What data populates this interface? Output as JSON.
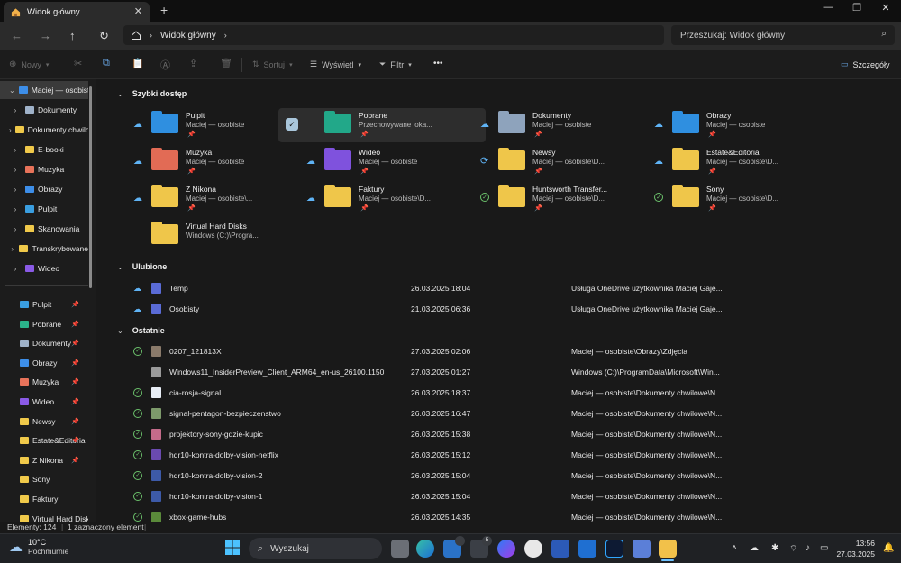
{
  "window": {
    "tab_title": "Widok główny",
    "new_tab": "+",
    "controls": [
      "—",
      "❐",
      "✕"
    ]
  },
  "address": {
    "breadcrumb": "Widok główny",
    "search_placeholder": "Przeszukaj: Widok główny"
  },
  "toolbar": {
    "new_label": "Nowy",
    "sort_label": "Sortuj",
    "view_label": "Wyświetl",
    "filter_label": "Filtr",
    "more_label": "•••",
    "details_label": "Szczegóły"
  },
  "sidebar": {
    "top": [
      {
        "label": "Maciej — osobiste",
        "color": "#3d8ee8"
      },
      {
        "label": "Dokumenty",
        "color": "#9fb2c9"
      },
      {
        "label": "Dokumenty chwilowe",
        "color": "#f0c94a"
      },
      {
        "label": "E-booki",
        "color": "#f0c94a"
      },
      {
        "label": "Muzyka",
        "color": "#e8735a"
      },
      {
        "label": "Obrazy",
        "color": "#3d8ee8"
      },
      {
        "label": "Pulpit",
        "color": "#3a9ee0"
      },
      {
        "label": "Skanowania",
        "color": "#f0c94a"
      },
      {
        "label": "Transkrybowane",
        "color": "#f0c94a"
      },
      {
        "label": "Wideo",
        "color": "#8a5ae6"
      }
    ],
    "pinned": [
      {
        "label": "Pulpit",
        "color": "#3a9ee0",
        "pin": "📌"
      },
      {
        "label": "Pobrane",
        "color": "#2bb38b",
        "pin": "📌"
      },
      {
        "label": "Dokumenty",
        "color": "#9fb2c9",
        "pin": "📌"
      },
      {
        "label": "Obrazy",
        "color": "#3d8ee8",
        "pin": "📌"
      },
      {
        "label": "Muzyka",
        "color": "#e8735a",
        "pin": "📌"
      },
      {
        "label": "Wideo",
        "color": "#8a5ae6",
        "pin": "📌"
      },
      {
        "label": "Newsy",
        "color": "#f0c94a",
        "pin": "📌"
      },
      {
        "label": "Estate&Editorial",
        "color": "#f0c94a",
        "pin": "📌"
      },
      {
        "label": "Z Nikona",
        "color": "#f0c94a",
        "pin": "📌"
      },
      {
        "label": "Sony",
        "color": "#f0c94a",
        "pin": ""
      },
      {
        "label": "Faktury",
        "color": "#f0c94a",
        "pin": ""
      },
      {
        "label": "Virtual Hard Disks",
        "color": "#f0c94a",
        "pin": ""
      }
    ]
  },
  "quick_access": {
    "title": "Szybki dostęp",
    "items": [
      {
        "name": "Pulpit",
        "sub": "Maciej — osobiste",
        "status": "cloud",
        "color": "#2f8fe0"
      },
      {
        "name": "Pobrane",
        "sub": "Przechowywane loka...",
        "status": "selected",
        "color": "#22a889"
      },
      {
        "name": "Dokumenty",
        "sub": "Maciej — osobiste",
        "status": "cloud",
        "color": "#8ea3bc"
      },
      {
        "name": "Obrazy",
        "sub": "Maciej — osobiste",
        "status": "cloud",
        "color": "#2f8fe0"
      },
      {
        "name": "Muzyka",
        "sub": "Maciej — osobiste",
        "status": "cloud",
        "color": "#e26b55"
      },
      {
        "name": "Wideo",
        "sub": "Maciej — osobiste",
        "status": "cloud",
        "color": "#7f52dd"
      },
      {
        "name": "Newsy",
        "sub": "Maciej — osobiste\\D...",
        "status": "sync",
        "color": "#efc64a"
      },
      {
        "name": "Estate&Editorial",
        "sub": "Maciej — osobiste\\D...",
        "status": "cloud",
        "color": "#efc64a"
      },
      {
        "name": "Z Nikona",
        "sub": "Maciej — osobiste\\...",
        "status": "cloud",
        "color": "#efc64a"
      },
      {
        "name": "Faktury",
        "sub": "Maciej — osobiste\\D...",
        "status": "cloud",
        "color": "#efc64a"
      },
      {
        "name": "Huntsworth Transfer...",
        "sub": "Maciej — osobiste\\D...",
        "status": "ok",
        "color": "#efc64a"
      },
      {
        "name": "Sony",
        "sub": "Maciej — osobiste\\D...",
        "status": "ok",
        "color": "#efc64a"
      },
      {
        "name": "Virtual Hard Disks",
        "sub": "Windows (C:)\\Progra...",
        "status": "",
        "color": "#efc64a"
      }
    ]
  },
  "favorites": {
    "title": "Ulubione",
    "rows": [
      {
        "name": "Temp",
        "date": "26.03.2025 18:04",
        "location": "Usługa OneDrive użytkownika Maciej Gaje...",
        "status": "cloud",
        "color": "#5a6bd6"
      },
      {
        "name": "Osobisty",
        "date": "21.03.2025 06:36",
        "location": "Usługa OneDrive użytkownika Maciej Gaje...",
        "status": "cloud",
        "color": "#5a6bd6"
      }
    ]
  },
  "recent": {
    "title": "Ostatnie",
    "rows": [
      {
        "name": "0207_121813X",
        "date": "27.03.2025 02:06",
        "location": "Maciej — osobiste\\Obrazy\\Zdjęcia",
        "status": "ok",
        "color": "#8a7a6a"
      },
      {
        "name": "Windows11_InsiderPreview_Client_ARM64_en-us_26100.1150",
        "date": "27.03.2025 01:27",
        "location": "Windows (C:)\\ProgramData\\Microsoft\\Win...",
        "status": "",
        "color": "#9a9a9a"
      },
      {
        "name": "cia-rosja-signal",
        "date": "26.03.2025 18:37",
        "location": "Maciej — osobiste\\Dokumenty chwilowe\\N...",
        "status": "ok",
        "color": "#e8eef6"
      },
      {
        "name": "signal-pentagon-bezpieczenstwo",
        "date": "26.03.2025 16:47",
        "location": "Maciej — osobiste\\Dokumenty chwilowe\\N...",
        "status": "ok",
        "color": "#7d9a6b"
      },
      {
        "name": "projektory-sony-gdzie-kupic",
        "date": "26.03.2025 15:38",
        "location": "Maciej — osobiste\\Dokumenty chwilowe\\N...",
        "status": "ok",
        "color": "#c46b8a"
      },
      {
        "name": "hdr10-kontra-dolby-vision-netflix",
        "date": "26.03.2025 15:12",
        "location": "Maciej — osobiste\\Dokumenty chwilowe\\N...",
        "status": "ok",
        "color": "#6a4ab0"
      },
      {
        "name": "hdr10-kontra-dolby-vision-2",
        "date": "26.03.2025 15:04",
        "location": "Maciej — osobiste\\Dokumenty chwilowe\\N...",
        "status": "ok",
        "color": "#3d5aa8"
      },
      {
        "name": "hdr10-kontra-dolby-vision-1",
        "date": "26.03.2025 15:04",
        "location": "Maciej — osobiste\\Dokumenty chwilowe\\N...",
        "status": "ok",
        "color": "#3d5aa8"
      },
      {
        "name": "xbox-game-hubs",
        "date": "26.03.2025 14:35",
        "location": "Maciej — osobiste\\Dokumenty chwilowe\\N...",
        "status": "ok",
        "color": "#5a8a3a"
      }
    ]
  },
  "statusbar": {
    "count": "Elementy: 124",
    "selected": "1 zaznaczony element"
  },
  "taskbar": {
    "weather_temp": "10°C",
    "weather_desc": "Pochmurnie",
    "search_label": "Wyszukaj",
    "time": "13:56",
    "date": "27.03.2025",
    "badge_a": "",
    "badge_b": "5"
  }
}
